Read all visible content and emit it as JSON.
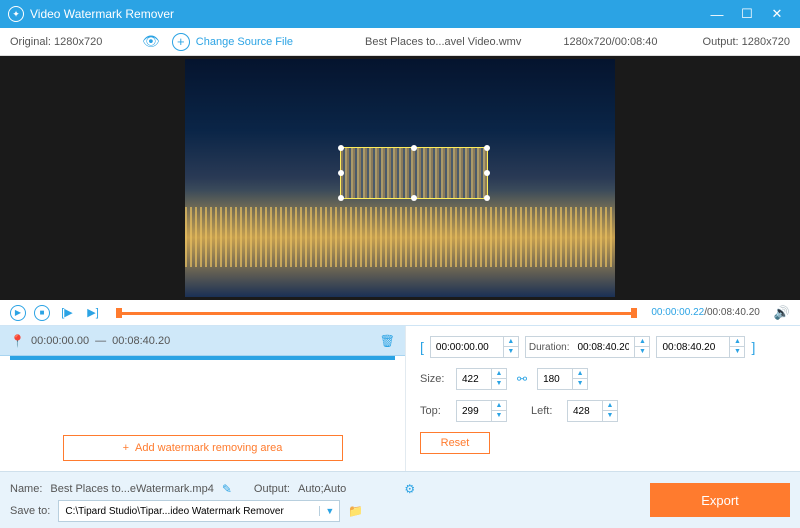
{
  "app": {
    "title": "Video Watermark Remover"
  },
  "infobar": {
    "original_label": "Original:",
    "original_res": "1280x720",
    "change_source": "Change Source File",
    "filename": "Best Places to...avel Video.wmv",
    "res_dur": "1280x720/00:08:40",
    "output_label": "Output:",
    "output_res": "1280x720"
  },
  "timeline": {
    "current": "00:00:00.22",
    "total": "00:08:40.20"
  },
  "segment": {
    "start": "00:00:00.00",
    "end": "00:08:40.20"
  },
  "add_area_label": "Add watermark removing area",
  "range": {
    "start": "00:00:00.00",
    "dur_label": "Duration:",
    "dur_value": "00:08:40.20",
    "end": "00:08:40.20"
  },
  "size": {
    "label": "Size:",
    "w": "422",
    "h": "180"
  },
  "pos": {
    "top_label": "Top:",
    "top": "299",
    "left_label": "Left:",
    "left": "428"
  },
  "reset_label": "Reset",
  "footer": {
    "name_label": "Name:",
    "name_value": "Best Places to...eWatermark.mp4",
    "output_label": "Output:",
    "output_value": "Auto;Auto",
    "save_label": "Save to:",
    "save_path": "C:\\Tipard Studio\\Tipar...ideo Watermark Remover",
    "export_label": "Export"
  }
}
